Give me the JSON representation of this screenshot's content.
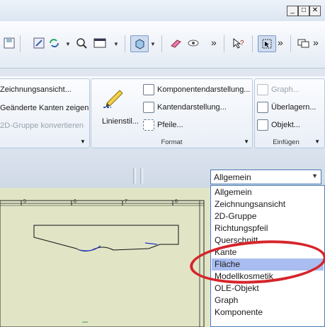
{
  "titlebar": {
    "buttons": [
      {
        "icon": "minimize-icon",
        "glyph": "_"
      },
      {
        "icon": "maximize-icon",
        "glyph": "□"
      },
      {
        "icon": "close-icon",
        "glyph": "✕"
      }
    ]
  },
  "toolbar": {
    "overflow_glyph": "»"
  },
  "ribbon": {
    "annotation_group": {
      "items": [
        "Zeichnungsansicht...",
        "Geänderte Kanten zeigen",
        "2D-Gruppe konvertieren"
      ]
    },
    "format_group": {
      "linestyle_label": "Linienstil...",
      "items": [
        "Komponentendarstellung...",
        "Kantendarstellung...",
        "Pfeile..."
      ],
      "footer": "Format"
    },
    "insert_group": {
      "items": [
        "Graph...",
        "Überlagern...",
        "Objekt..."
      ],
      "footer": "Einfügen"
    }
  },
  "filter": {
    "selected": "Allgemein",
    "options": [
      "Allgemein",
      "Zeichnungsansicht",
      "2D-Gruppe",
      "Richtungspfeil",
      "Querschnitt",
      "Kante",
      "Fläche",
      "Modellkosmetik",
      "OLE-Objekt",
      "Graph",
      "Komponente"
    ],
    "highlighted_index": 6
  },
  "drawing": {
    "ruler_numbers": [
      "5",
      "6",
      "7",
      "8"
    ]
  },
  "colors": {
    "highlight": "#a9bdf0",
    "annotation_circle": "#d6242b",
    "canvas": "#e1e5c6"
  }
}
